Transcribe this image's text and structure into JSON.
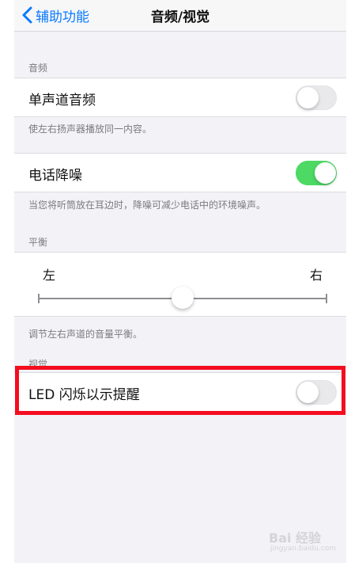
{
  "nav": {
    "back_label": "辅助功能",
    "title": "音频/视觉"
  },
  "audio_section": {
    "header": "音频",
    "mono_audio": {
      "label": "单声道音频",
      "on": false
    },
    "mono_footer": "使左右扬声器播放同一内容。",
    "noise_cancel": {
      "label": "电话降噪",
      "on": true
    },
    "noise_footer": "当您将听筒放在耳边时，降噪可减少电话中的环境噪声。"
  },
  "balance_section": {
    "header": "平衡",
    "left_label": "左",
    "right_label": "右",
    "value_fraction": 0.5,
    "footer": "调节左右声道的音量平衡。"
  },
  "visual_section": {
    "header": "视觉",
    "led_flash": {
      "label": "LED 闪烁以示提醒",
      "on": false
    }
  },
  "watermark": {
    "logo_text": "Bai 经验",
    "sub_text": "jingyan.baidu.com"
  },
  "colors": {
    "accent": "#0a7aff",
    "toggle_on": "#4dd964",
    "highlight": "#f40d1f"
  }
}
